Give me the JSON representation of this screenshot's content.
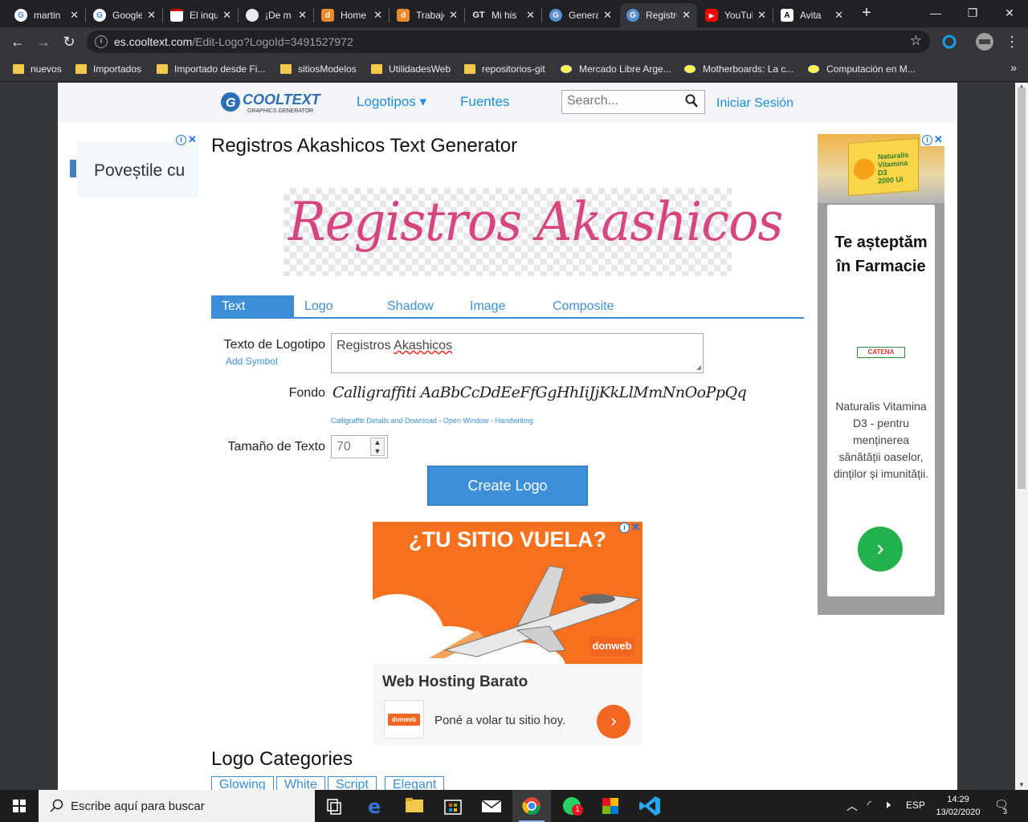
{
  "browser": {
    "tabs": [
      {
        "label": "martin",
        "favicon": "google-icon"
      },
      {
        "label": "Google",
        "favicon": "google-icon"
      },
      {
        "label": "El inquilino",
        "favicon": "news-icon"
      },
      {
        "label": "¡De m",
        "favicon": "globe-icon"
      },
      {
        "label": "Home",
        "favicon": "d-icon"
      },
      {
        "label": "Trabajo",
        "favicon": "d-icon"
      },
      {
        "label": "Mi his",
        "favicon": "gt-icon"
      },
      {
        "label": "Generador",
        "favicon": "cooltext-icon"
      },
      {
        "label": "Registros",
        "favicon": "cooltext-icon"
      },
      {
        "label": "YouTube",
        "favicon": "youtube-icon"
      },
      {
        "label": "Avita",
        "favicon": "a-icon"
      }
    ],
    "url_host": "es.cooltext.com",
    "url_path": "/Edit-Logo?LogoId=3491527972",
    "bookmarks": [
      {
        "label": "nuevos",
        "icon": "folder-icon"
      },
      {
        "label": "Importados",
        "icon": "folder-icon"
      },
      {
        "label": "Importado desde Fi...",
        "icon": "folder-icon"
      },
      {
        "label": "sitiosModelos",
        "icon": "folder-icon"
      },
      {
        "label": "UtilidadesWeb",
        "icon": "folder-icon"
      },
      {
        "label": "repositorios-git",
        "icon": "folder-icon"
      },
      {
        "label": "Mercado Libre Arge...",
        "icon": "mercadolibre-icon"
      },
      {
        "label": "Motherboards: La c...",
        "icon": "mercadolibre-icon"
      },
      {
        "label": "Computación en M...",
        "icon": "mercadolibre-icon"
      }
    ],
    "bookmarks_more": "»"
  },
  "site": {
    "logo_text": "COOLTEXT",
    "logo_sub": "GRAPHICS GENERATOR",
    "nav": {
      "logotipos": "Logotipos ▾",
      "fuentes": "Fuentes"
    },
    "search_placeholder": "Search...",
    "login": "Iniciar Sesión"
  },
  "main": {
    "title": "Registros Akashicos Text Generator",
    "preview_text": "Registros Akashicos",
    "tabs": [
      "Text",
      "Logo",
      "Shadow",
      "Image",
      "Composite"
    ],
    "form": {
      "text_label": "Texto de Logotipo",
      "add_symbol": "Add Symbol",
      "text_value_1": "Registros ",
      "text_value_2": "Akashicos",
      "font_label": "Fondo",
      "font_sample": "Calligraffiti AaBbCcDdEeFfGgHhIiJjKkLlMmNnOoPpQq",
      "font_link_details": "Calligraffiti Details and Download",
      "font_link_open": "Open Window",
      "font_link_style": "Handwriting",
      "font_link_sep": " - ",
      "size_label": "Tamaño de Texto",
      "size_value": "70",
      "create_button": "Create Logo"
    },
    "categories_title": "Logo Categories",
    "categories": [
      "Glowing",
      "White",
      "Script",
      "Elegant"
    ]
  },
  "ads": {
    "left_text": "Poveștile cu",
    "mid": {
      "headline": "¿TU SITIO VUELA?",
      "brand": "donweb",
      "title": "Web Hosting Barato",
      "slogan": "Poné a volar tu sitio hoy.",
      "go": "›"
    },
    "right": {
      "product_brand": "Naturalis",
      "product_name": "Vitamina D3",
      "product_dose": "2000 UI",
      "title": "Te așteptăm în Farmacie",
      "store": "CATENA",
      "desc": "Naturalis Vitamina D3 - pentru menținerea sănătății oaselor, dinților și imunității.",
      "go": "›"
    }
  },
  "taskbar": {
    "search_placeholder": "Escribe aquí para buscar",
    "lang": "ESP",
    "time": "14:29",
    "date": "13/02/2020",
    "whatsapp_badge": "1",
    "notif_count": "3"
  },
  "colors": {
    "accent": "#3c8fd6",
    "script_pink": "#d6457f",
    "chrome_dark": "#202124"
  }
}
